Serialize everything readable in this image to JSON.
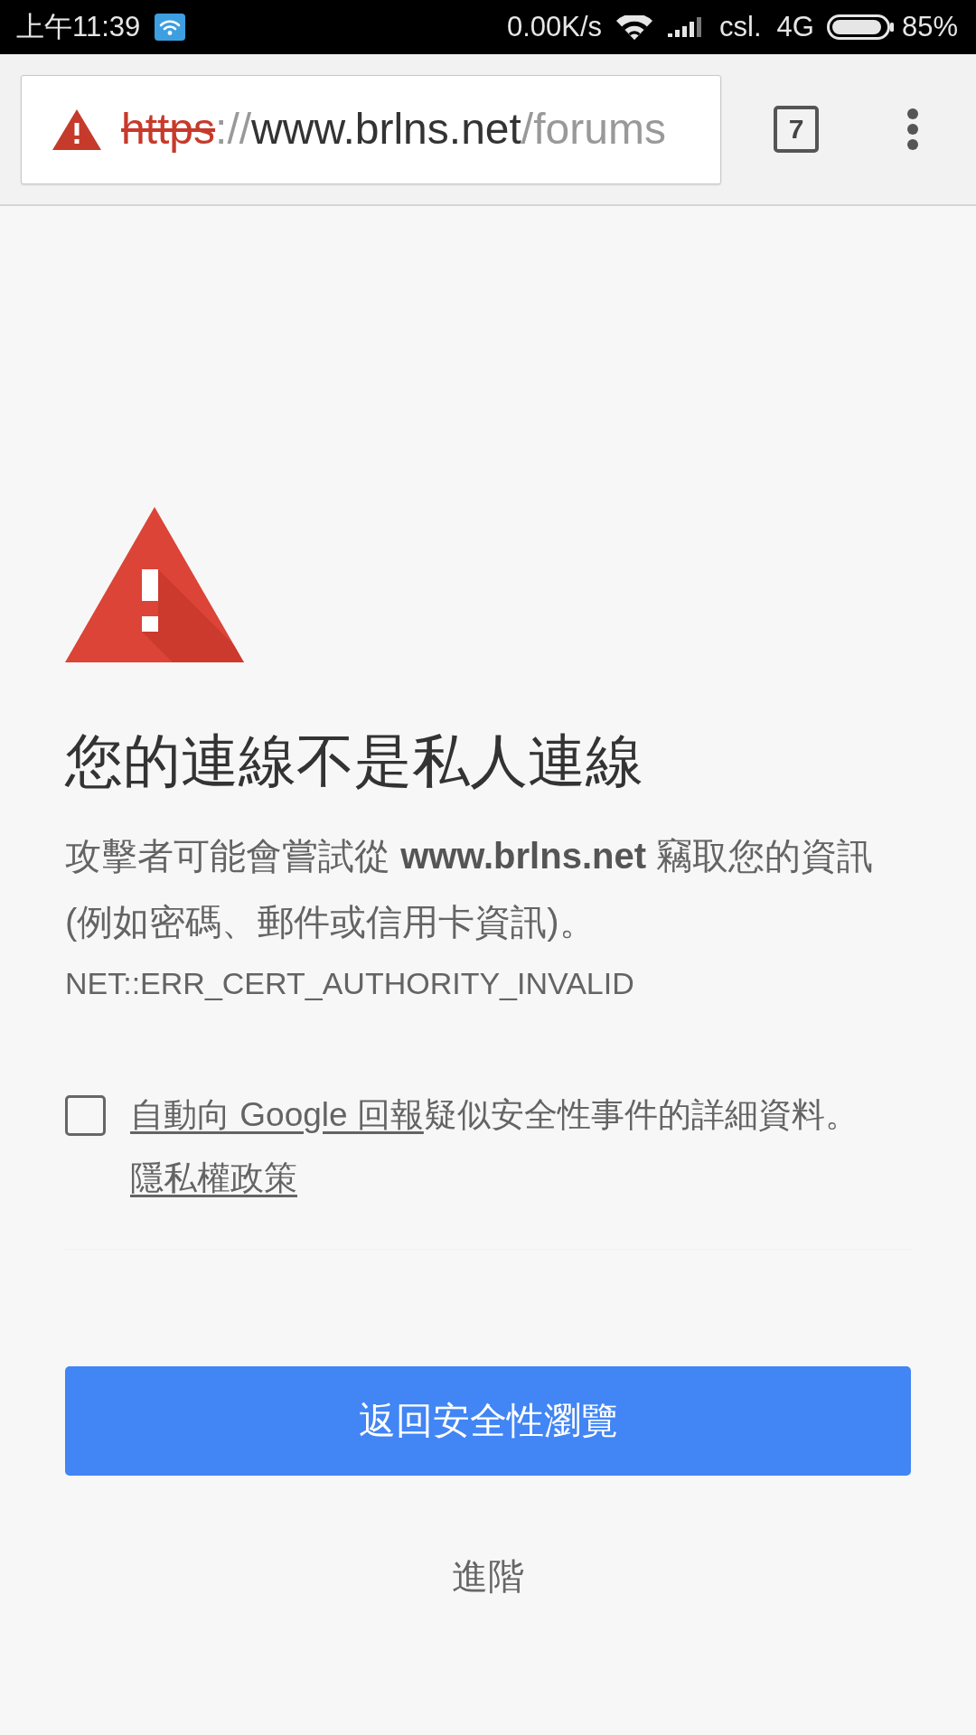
{
  "status_bar": {
    "time": "上午11:39",
    "net_speed": "0.00K/s",
    "carrier": "csl.",
    "network": "4G",
    "battery": "85%"
  },
  "toolbar": {
    "connection_secure": false,
    "url": [
      {
        "text": "https",
        "kind": "scheme"
      },
      {
        "text": "://",
        "kind": "separator"
      },
      {
        "text": "www.brlns.net",
        "kind": "host"
      },
      {
        "text": "/forums",
        "kind": "path"
      }
    ],
    "tab_count": "7"
  },
  "interstitial": {
    "heading": "您的連線不是私人連線",
    "message": "攻擊者可能會嘗試從 **www.brlns.net** 竊取您的資訊(例如密碼、郵件或信用卡資訊)。",
    "error_code": "NET::ERR_CERT_AUTHORITY_INVALID",
    "report": {
      "checked": false,
      "link": "自動向 Google 回報",
      "text": "疑似安全性事件的詳細資料。",
      "privacy_link": "隱私權政策"
    },
    "primary_button": "返回安全性瀏覽",
    "secondary_button": "進階"
  }
}
